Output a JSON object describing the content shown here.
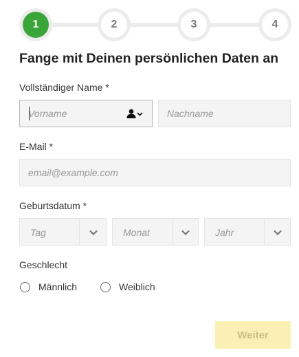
{
  "stepper": {
    "steps": [
      "1",
      "2",
      "3",
      "4"
    ],
    "active": 1
  },
  "form": {
    "heading": "Fange mit Deinen persönlichen Daten an",
    "name": {
      "label": "Vollständiger Name *",
      "first_placeholder": "Vorname",
      "last_placeholder": "Nachname",
      "contact_icon": "person-icon"
    },
    "email": {
      "label": "E-Mail *",
      "placeholder": "email@example.com"
    },
    "birthdate": {
      "label": "Geburtsdatum *",
      "day_placeholder": "Tag",
      "month_placeholder": "Monat",
      "year_placeholder": "Jahr"
    },
    "gender": {
      "label": "Geschlecht",
      "options": [
        "Männlich",
        "Weiblich"
      ]
    },
    "submit_label": "Weiter"
  },
  "colors": {
    "active_step": "#3aa63a",
    "button_bg": "#faf0b4",
    "button_text": "#c9bf84"
  }
}
